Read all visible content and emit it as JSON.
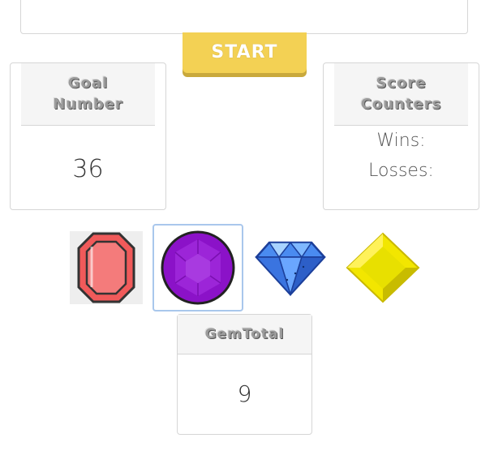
{
  "start_button": {
    "label": "START"
  },
  "goal": {
    "title_line1": "Goal",
    "title_line2": "Number",
    "value": "36"
  },
  "score": {
    "title_line1": "Score",
    "title_line2": "Counters",
    "wins_label": "Wins:",
    "losses_label": "Losses:"
  },
  "gems": [
    {
      "icon": "red-gem-icon",
      "color": "#f05a5a"
    },
    {
      "icon": "purple-gem-icon",
      "color": "#8b12c8"
    },
    {
      "icon": "blue-diamond-icon",
      "color": "#4a8bf0"
    },
    {
      "icon": "yellow-gem-icon",
      "color": "#f2e600"
    }
  ],
  "gem_total": {
    "title": "GemTotal",
    "value": "9"
  },
  "colors": {
    "start_button": "#f3d154",
    "selected_border": "#a9c7ec",
    "header_bg": "#f5f5f5"
  }
}
